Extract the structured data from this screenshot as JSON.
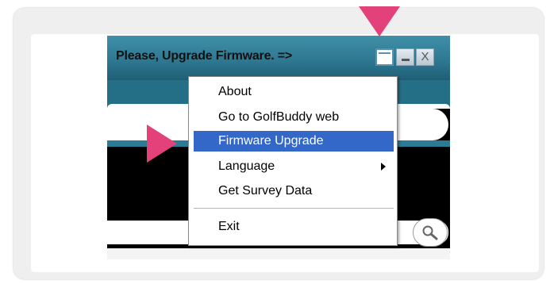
{
  "window": {
    "title": "Please, Upgrade Firmware. =>",
    "buttons": {
      "minimize": "_",
      "close": "X"
    }
  },
  "context_menu": {
    "items": [
      {
        "label": "About"
      },
      {
        "label": "Go to GolfBuddy web"
      },
      {
        "label": "Firmware Upgrade",
        "highlighted": true
      },
      {
        "label": "Language",
        "has_submenu": true
      },
      {
        "label": "Get Survey Data"
      },
      {
        "label": "Exit"
      }
    ]
  },
  "annotations": {
    "color": "#e2417a",
    "pointers": [
      "arrow-pointing-at-maximize-button",
      "arrow-pointing-at-firmware-upgrade"
    ]
  },
  "colors": {
    "title_bar": "#2d7690",
    "menu_highlight": "#3367c8"
  }
}
